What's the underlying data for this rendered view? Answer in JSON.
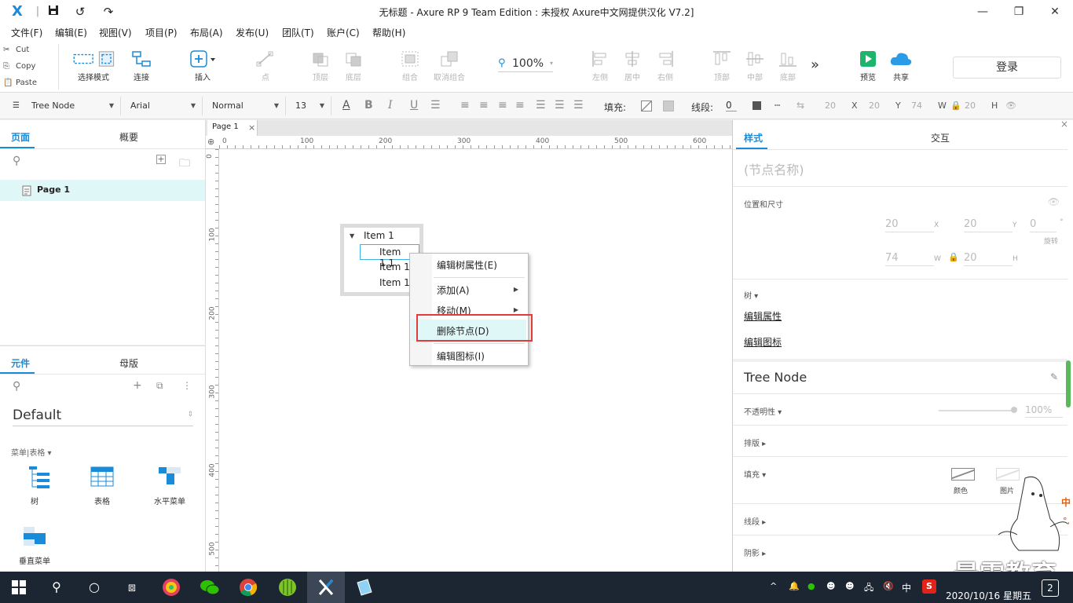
{
  "titlebar": {
    "title": "无标题 - Axure RP 9 Team Edition : 未授权     Axure中文网提供汉化 V7.2]",
    "logo": "X",
    "sep": "|"
  },
  "menu": [
    "文件(F)",
    "编辑(E)",
    "视图(V)",
    "项目(P)",
    "布局(A)",
    "发布(U)",
    "团队(T)",
    "账户(C)",
    "帮助(H)"
  ],
  "clipboard": {
    "cut": "Cut",
    "copy": "Copy",
    "paste": "Paste"
  },
  "toolbar": {
    "select_mode": "选择模式",
    "connect": "连接",
    "insert": "插入",
    "point": "点",
    "top_layer": "顶层",
    "bottom_layer": "底层",
    "group": "组合",
    "ungroup": "取消组合",
    "zoom": "100%",
    "align_left": "左侧",
    "align_center": "居中",
    "align_right": "右侧",
    "align_top": "顶部",
    "align_middle": "中部",
    "align_bottom": "底部",
    "more": "»",
    "preview": "预览",
    "share": "共享",
    "login": "登录"
  },
  "format": {
    "widget_type": "Tree Node",
    "font": "Arial",
    "weight": "Normal",
    "size": "13",
    "bold": "B",
    "italic": "I",
    "underline": "U",
    "fill_label": "填充:",
    "stroke_label": "线段:",
    "stroke_value": "0",
    "x_val": "20",
    "x_lbl": "X",
    "y_val": "20",
    "y_lbl": "Y",
    "w_val": "74",
    "w_lbl": "W",
    "h_val": "20",
    "h_lbl": "H"
  },
  "pages_panel": {
    "tab_pages": "页面",
    "tab_outline": "概要",
    "page_item": "Page 1"
  },
  "widgets_panel": {
    "tab_widgets": "元件",
    "tab_masters": "母版",
    "library": "Default",
    "category": "菜单|表格 ▾",
    "items": [
      "树",
      "表格",
      "水平菜单",
      "垂直菜单"
    ]
  },
  "canvas": {
    "tab": "Page 1",
    "tab_close": "×",
    "hruler": [
      "0",
      "100",
      "200",
      "300",
      "400",
      "500",
      "600"
    ],
    "vruler": [
      "0",
      "100",
      "200",
      "300",
      "400",
      "500"
    ],
    "tree": {
      "root": "Item 1",
      "children": [
        "Item 1.1",
        "Item 1",
        "Item 1"
      ]
    }
  },
  "context_menu": {
    "edit_tree_props": "编辑树属性(E)",
    "add": "添加(A)",
    "move": "移动(M)",
    "delete_node": "删除节点(D)",
    "edit_icon": "编辑图标(I)",
    "highlight_color": "#e23b3b"
  },
  "right_panel": {
    "tab_style": "样式",
    "tab_interact": "交互",
    "node_name_placeholder": "(节点名称)",
    "pos_size": "位置和尺寸",
    "x": "20",
    "x_lbl": "X",
    "y": "20",
    "y_lbl": "Y",
    "rot": "0",
    "rot_unit": "°",
    "rot_lbl": "旋转",
    "w": "74",
    "w_lbl": "W",
    "h": "20",
    "h_lbl": "H",
    "tree_label": "树 ▾",
    "edit_props": "编辑属性",
    "edit_icon": "编辑图标",
    "widget_name": "Tree Node",
    "opacity_label": "不透明性 ▾",
    "opacity_val": "100%",
    "layout_label": "排版 ▸",
    "fill_label": "填充 ▾",
    "fill_color": "颜色",
    "fill_image": "图片",
    "stroke_label": "线段 ▸",
    "shadow_label": "阴影 ▸"
  },
  "watermark": {
    "brand": "最需教育",
    "side": [
      "中",
      "°,"
    ]
  },
  "taskbar": {
    "ime": "中",
    "datetime": "2020/10/16 星期五",
    "notification_count": "2"
  },
  "colors": {
    "accent": "#1a8bd8",
    "preview_green": "#1db56b",
    "share_blue": "#2a9be6"
  }
}
